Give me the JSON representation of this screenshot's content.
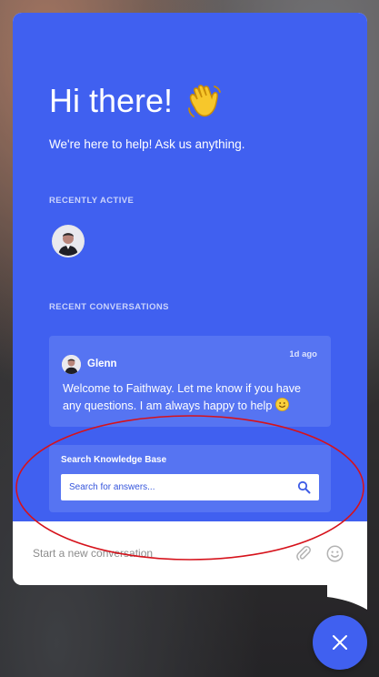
{
  "hero": {
    "greeting": "Hi there!",
    "greeting_emoji": "waving-hand-icon",
    "subtitle": "We're here to help! Ask us anything.",
    "recently_active_label": "RECENTLY ACTIVE",
    "recent_conversations_label": "RECENT CONVERSATIONS"
  },
  "conversation": {
    "author": "Glenn",
    "time": "1d ago",
    "message": "Welcome to Faithway. Let me know if you have any questions. I am always happy to help",
    "message_emoji": "smiling-face-icon"
  },
  "knowledge_base": {
    "title": "Search Knowledge Base",
    "placeholder": "Search for answers..."
  },
  "composer": {
    "placeholder": "Start a new conversation"
  },
  "colors": {
    "brand_blue": "#4060f0",
    "card_blue": "#5674f2",
    "annotation_red": "#d6121b"
  }
}
